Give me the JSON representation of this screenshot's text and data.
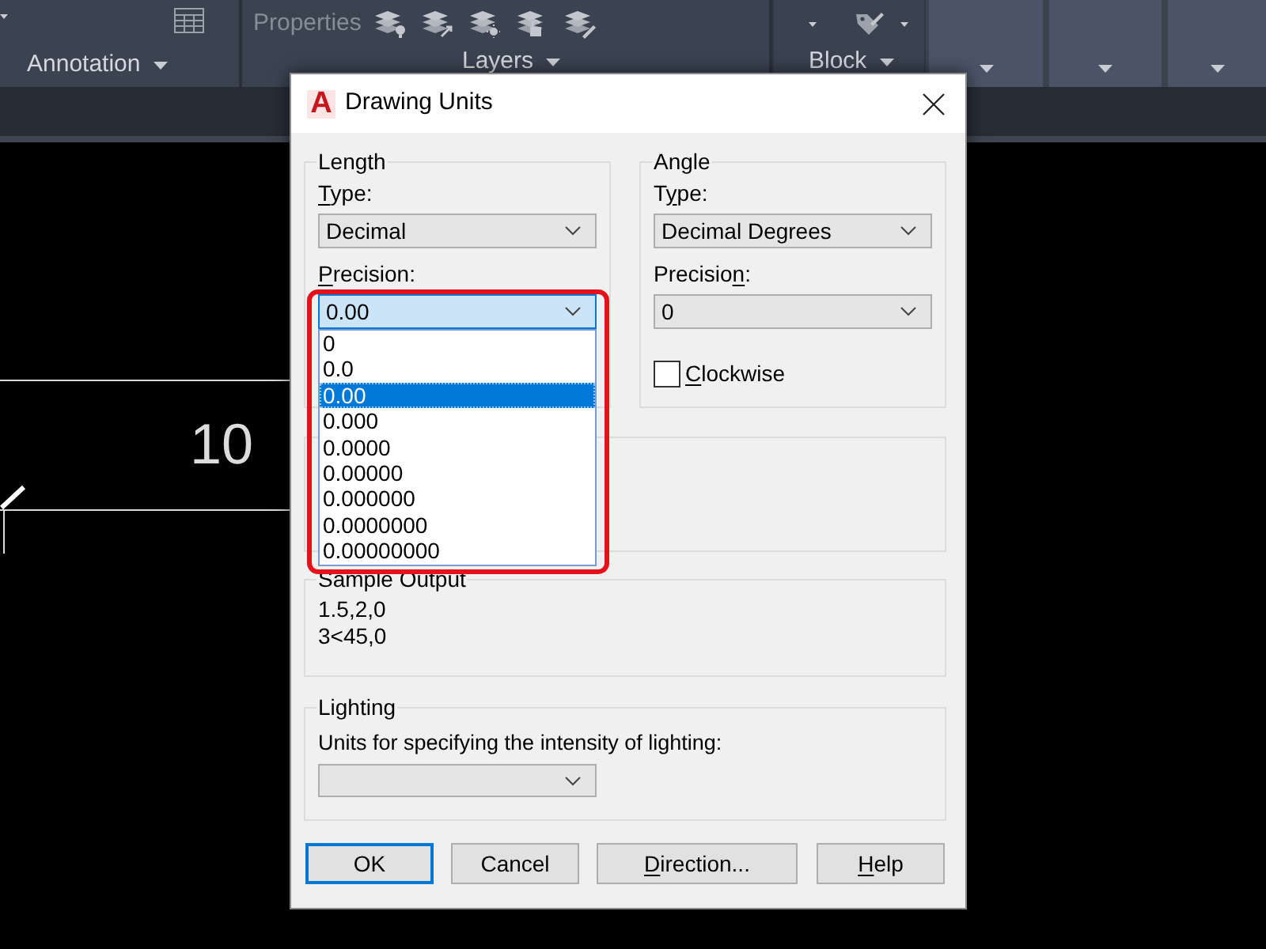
{
  "ribbon": {
    "annotation_panel": {
      "label": "Annotation"
    },
    "layers_panel": {
      "tool_label": "Properties",
      "label": "Layers"
    },
    "block_panel": {
      "label": "Block"
    }
  },
  "canvas": {
    "dimension_text": "10"
  },
  "dialog": {
    "logo": "A",
    "title": "Drawing Units",
    "length": {
      "title": "Length",
      "type": {
        "label": [
          {
            "text": "T",
            "underline": true
          },
          {
            "text": "ype:",
            "underline": false
          }
        ],
        "value": "Decimal"
      },
      "precision": {
        "label": [
          {
            "text": "P",
            "underline": true
          },
          {
            "text": "recision:",
            "underline": false
          }
        ],
        "value": "0.00",
        "expanded": true,
        "highlighted": true,
        "options": [
          {
            "label": "0",
            "selected": false
          },
          {
            "label": "0.0",
            "selected": false
          },
          {
            "label": "0.00",
            "selected": true
          },
          {
            "label": "0.000",
            "selected": false
          },
          {
            "label": "0.0000",
            "selected": false
          },
          {
            "label": "0.00000",
            "selected": false
          },
          {
            "label": "0.000000",
            "selected": false
          },
          {
            "label": "0.0000000",
            "selected": false
          },
          {
            "label": "0.00000000",
            "selected": false
          }
        ]
      }
    },
    "angle": {
      "title": "Angle",
      "type": {
        "label": [
          {
            "text": "T",
            "underline": false
          },
          {
            "text": "y",
            "underline": true
          },
          {
            "text": "pe:",
            "underline": false
          }
        ],
        "value": "Decimal Degrees"
      },
      "precision": {
        "label": [
          {
            "text": "Precisio",
            "underline": false
          },
          {
            "text": "n",
            "underline": true
          },
          {
            "text": ":",
            "underline": false
          }
        ],
        "value": "0"
      },
      "clockwise": {
        "label": [
          {
            "text": "C",
            "underline": true
          },
          {
            "text": "lockwise",
            "underline": false
          }
        ],
        "checked": false
      }
    },
    "sample_output": {
      "title": "Sample Output",
      "lines": [
        "1.5,2,0",
        "3<45,0"
      ]
    },
    "lighting": {
      "title": "Lighting",
      "prompt": "Units for specifying the intensity of lighting:"
    },
    "buttons": [
      {
        "label": "OK",
        "default": true
      },
      {
        "label": "Cancel",
        "default": false
      },
      {
        "label": [
          {
            "text": "D",
            "underline": true
          },
          {
            "text": "irection...",
            "underline": false
          }
        ],
        "default": false
      },
      {
        "label": [
          {
            "text": "H",
            "underline": true
          },
          {
            "text": "elp",
            "underline": false
          }
        ],
        "default": false
      }
    ]
  }
}
